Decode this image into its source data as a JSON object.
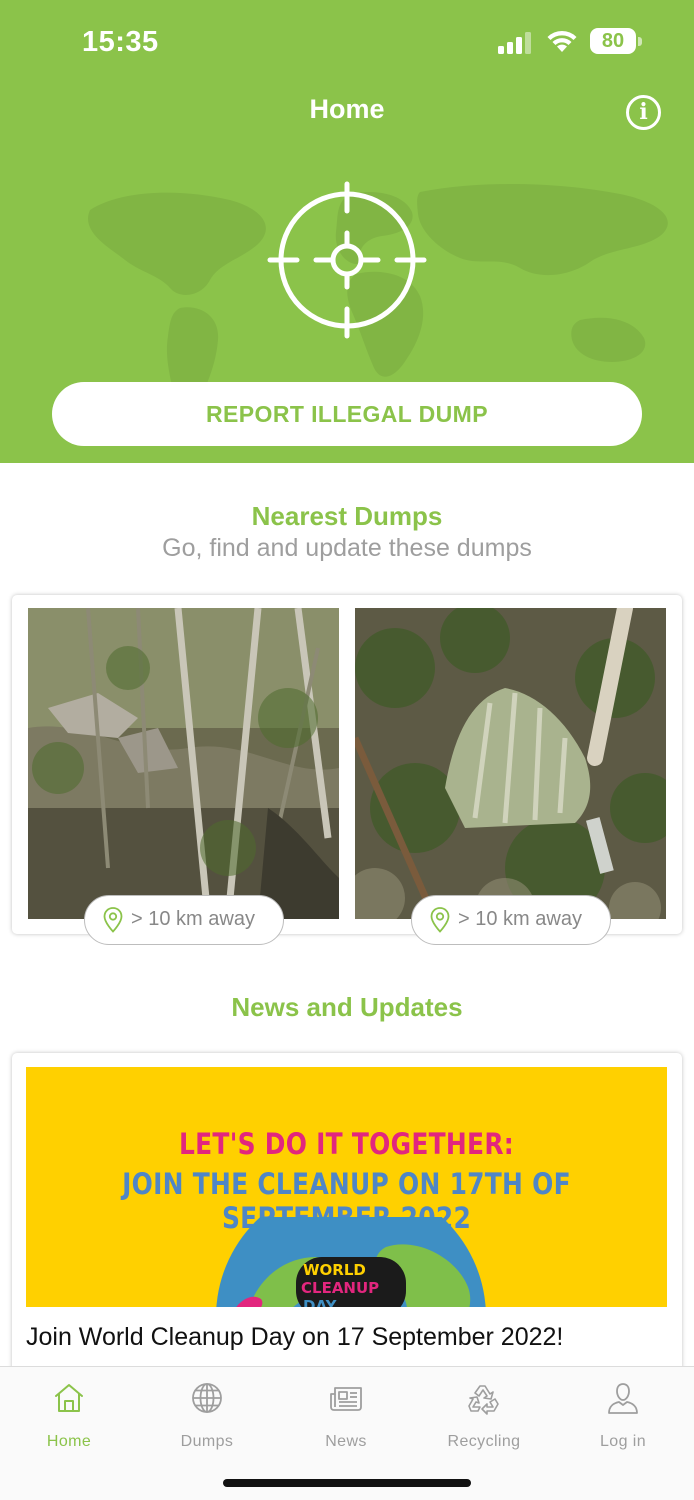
{
  "status_bar": {
    "time": "15:35",
    "battery": "80",
    "signal_icon": "cellular-signal-icon",
    "wifi_icon": "wifi-icon"
  },
  "header": {
    "title": "Home",
    "info_icon_glyph": "i",
    "target_icon": "crosshair-target-icon",
    "report_button_label": "REPORT ILLEGAL DUMP",
    "background_color": "#8bc34a"
  },
  "nearest_dumps": {
    "title": "Nearest Dumps",
    "subtitle": "Go, find and update these dumps",
    "items": [
      {
        "distance": "> 10 km away"
      },
      {
        "distance": "> 10 km away"
      }
    ]
  },
  "news": {
    "title": "News and Updates",
    "items": [
      {
        "banner_line1": "LET'S DO IT TOGETHER:",
        "banner_line2": "JOIN THE CLEANUP ON 17TH OF SEPTEMBER 2022",
        "banner_logo_text": [
          "WORLD",
          "CLEANUP",
          "DAY"
        ],
        "title": "Join World Cleanup Day on 17 September 2022!"
      }
    ]
  },
  "tabs": [
    {
      "label": "Home",
      "icon": "home-icon",
      "active": true
    },
    {
      "label": "Dumps",
      "icon": "globe-icon",
      "active": false
    },
    {
      "label": "News",
      "icon": "newspaper-icon",
      "active": false
    },
    {
      "label": "Recycling",
      "icon": "recycle-icon",
      "active": false
    },
    {
      "label": "Log in",
      "icon": "user-icon",
      "active": false
    }
  ],
  "colors": {
    "accent": "#8bc34a",
    "muted_text": "#9e9e9e",
    "banner_yellow": "#ffd000",
    "banner_pink": "#e2267e",
    "banner_blue": "#4f86c6"
  }
}
